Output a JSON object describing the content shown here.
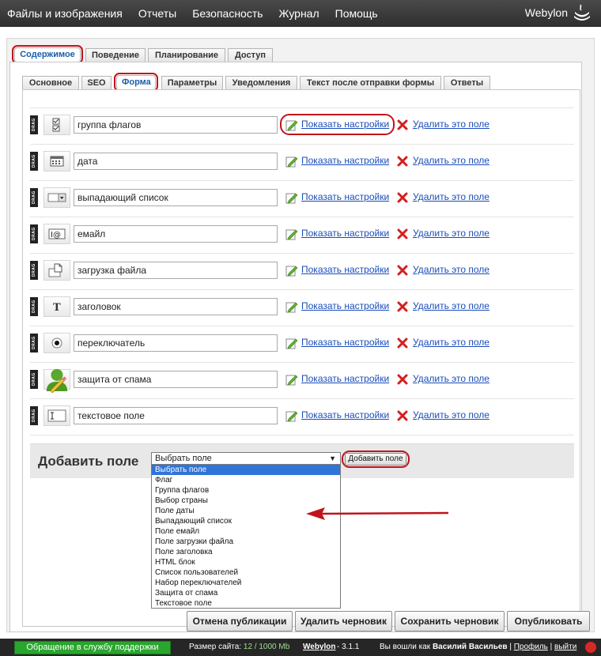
{
  "topbar": {
    "menu": [
      "Файлы и изображения",
      "Отчеты",
      "Безопасность",
      "Журнал",
      "Помощь"
    ],
    "logo": "Webylon"
  },
  "tabs_main": [
    "Содержимое",
    "Поведение",
    "Планирование",
    "Доступ"
  ],
  "tabs_sub": [
    "Основное",
    "SEO",
    "Форма",
    "Параметры",
    "Уведомления",
    "Текст после отправки формы",
    "Ответы"
  ],
  "fields": [
    {
      "value": "группа флагов",
      "icon": "checkbox-group-icon"
    },
    {
      "value": "дата",
      "icon": "calendar-icon"
    },
    {
      "value": "выпадающий список",
      "icon": "dropdown-icon"
    },
    {
      "value": "емайл",
      "icon": "email-icon"
    },
    {
      "value": "загрузка файла",
      "icon": "file-upload-icon"
    },
    {
      "value": "заголовок",
      "icon": "heading-icon"
    },
    {
      "value": "переключатель",
      "icon": "radio-icon"
    },
    {
      "value": "защита от спама",
      "icon": "spam-protection-icon"
    },
    {
      "value": "текстовое поле",
      "icon": "text-field-icon"
    }
  ],
  "row_actions": {
    "drag": "DRAG",
    "show_settings": "Показать настройки",
    "delete_field": "Удалить это поле"
  },
  "add_field": {
    "title": "Добавить поле",
    "selected": "Выбрать поле",
    "button": "Добавить поле",
    "options": [
      "Выбрать поле",
      "Флаг",
      "Группа флагов",
      "Выбор страны",
      "Поле даты",
      "Выпадающий список",
      "Поле емайл",
      "Поле загрузки файла",
      "Поле заголовка",
      "HTML блок",
      "Список пользователей",
      "Набор переключателей",
      "Защита от спама",
      "Текстовое поле"
    ]
  },
  "bottom_buttons": [
    "Отмена публикации",
    "Удалить черновик",
    "Сохранить черновик",
    "Опубликовать"
  ],
  "footer": {
    "support": "Обращение в службу поддержки",
    "size_label": "Размер сайта:",
    "size_value": "12 / 1000 Mb",
    "brand": "Webylon",
    "version": "-  3.1.1",
    "logged_prefix": "Вы вошли как",
    "user_name": "Василий Васильев",
    "profile": "Профиль",
    "logout": "выйти"
  },
  "colors": {
    "highlight": "#c0141c",
    "link": "#1a4dba",
    "support": "#29a62d"
  }
}
